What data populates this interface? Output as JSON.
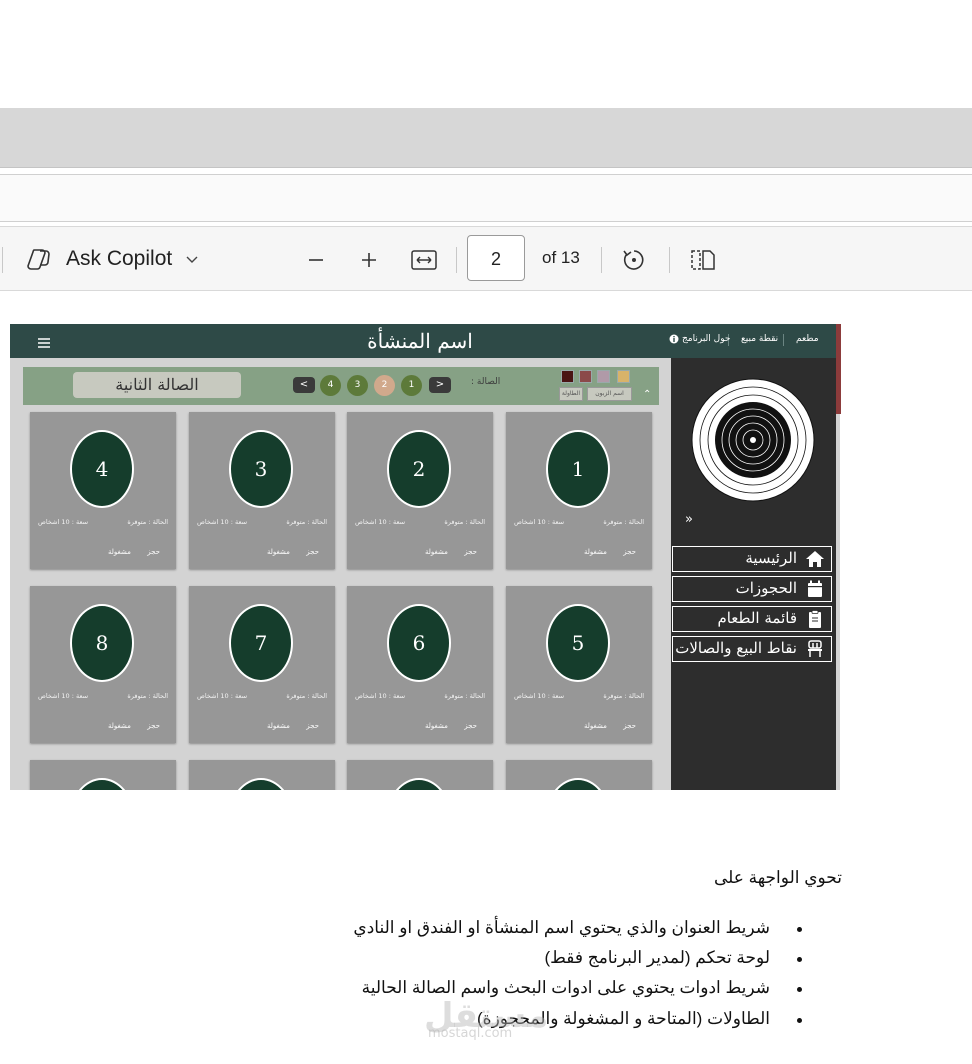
{
  "viewer": {
    "copilot_label": "Ask Copilot",
    "page_current": "2",
    "page_total": "of 13"
  },
  "app": {
    "title": "اسم المنشأة",
    "header_nav": [
      "مطعم",
      "نقطة مبيع",
      "حول البرنامج"
    ],
    "hall_name": "الصالة الثانية",
    "hall_label": "الصالة :",
    "hall_pages": [
      "1",
      "2",
      "3",
      "4"
    ],
    "filter_buttons": [
      "اسم الزبون",
      "الطاولة"
    ],
    "sidebar_nav": [
      {
        "label": "الرئيسية",
        "icon": "home-icon"
      },
      {
        "label": "الحجوزات",
        "icon": "calendar-icon"
      },
      {
        "label": "قائمة الطعام",
        "icon": "clipboard-icon"
      },
      {
        "label": "نقاط البيع والصالات",
        "icon": "chair-icon"
      }
    ],
    "tables": [
      {
        "num": "4",
        "status": "الحالة : متوفرة",
        "capacity": "سعة : 10 اشخاص",
        "book": "حجز",
        "busy": "مشغولة"
      },
      {
        "num": "3",
        "status": "الحالة : متوفرة",
        "capacity": "سعة : 10 اشخاص",
        "book": "حجز",
        "busy": "مشغولة"
      },
      {
        "num": "2",
        "status": "الحالة : متوفرة",
        "capacity": "سعة : 10 اشخاص",
        "book": "حجز",
        "busy": "مشغولة"
      },
      {
        "num": "1",
        "status": "الحالة : متوفرة",
        "capacity": "سعة : 10 اشخاص",
        "book": "حجز",
        "busy": "مشغولة"
      },
      {
        "num": "8",
        "status": "الحالة : متوفرة",
        "capacity": "سعة : 10 اشخاص",
        "book": "حجز",
        "busy": "مشغولة"
      },
      {
        "num": "7",
        "status": "الحالة : متوفرة",
        "capacity": "سعة : 10 اشخاص",
        "book": "حجز",
        "busy": "مشغولة"
      },
      {
        "num": "6",
        "status": "الحالة : متوفرة",
        "capacity": "سعة : 10 اشخاص",
        "book": "حجز",
        "busy": "مشغولة"
      },
      {
        "num": "5",
        "status": "الحالة : متوفرة",
        "capacity": "سعة : 10 اشخاص",
        "book": "حجز",
        "busy": "مشغولة"
      }
    ],
    "colors": {
      "header": "#2e4a47",
      "hallbar": "#86a185",
      "table_circle": "#153d2c",
      "sidebar": "#2d2d2d"
    }
  },
  "doc": {
    "intro": "تحوي الواجهة على",
    "bullets": [
      "شريط العنوان والذي يحتوي اسم المنشأة او الفندق او النادي",
      "لوحة تحكم (لمدير البرنامج فقط)",
      "شريط ادوات يحتوي على ادوات البحث  واسم الصالة الحالية",
      "الطاولات (المتاحة و المشغولة والمحجوزة)"
    ],
    "watermark": "مستقل",
    "watermark_sub": "mostaql.com"
  }
}
